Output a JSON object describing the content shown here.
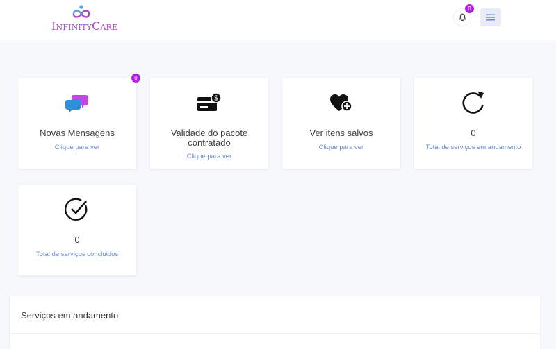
{
  "header": {
    "logo_text_part1": "Infinity",
    "logo_text_part2": "Care",
    "notifications_count": "0",
    "menu_icon": "hamburger-icon"
  },
  "cards": [
    {
      "icon": "chat-bubbles-icon",
      "title": "Novas Mensagens",
      "link": "Clique para ver",
      "badge": "0"
    },
    {
      "icon": "card-dollar-icon",
      "title": "Validade do pacote contratado",
      "link": "Clique para ver"
    },
    {
      "icon": "heart-plus-icon",
      "title": "Ver itens salvos",
      "link": "Clique para ver"
    },
    {
      "icon": "refresh-icon",
      "title": "0",
      "link": "Total de serviços em andamento"
    },
    {
      "icon": "check-circle-icon",
      "title": "0",
      "link": "Total de serviços concluidos"
    }
  ],
  "panel": {
    "title": "Serviços em andamento"
  },
  "colors": {
    "brand": "#a24bd6",
    "badge": "#b21fe0",
    "link": "#6a8bd1",
    "chat_blue": "#2f8fd8",
    "chat_purple": "#c048e6"
  }
}
